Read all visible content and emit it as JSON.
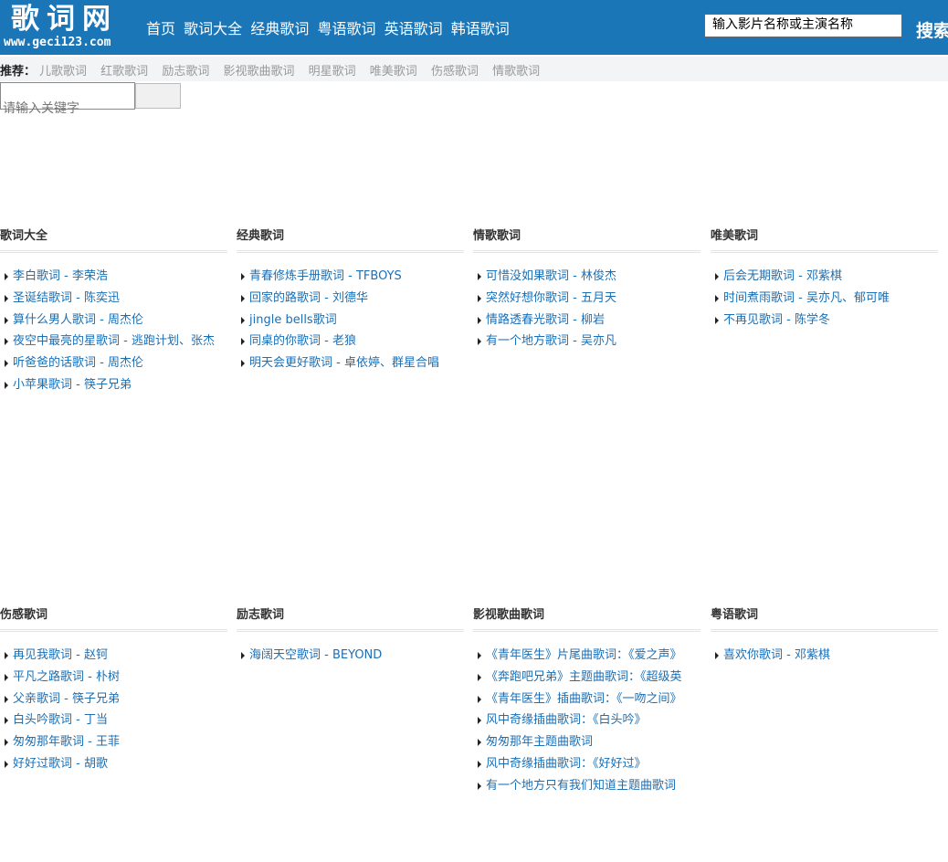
{
  "header": {
    "logo_title": "歌词网",
    "logo_url": "www.geci123.com",
    "nav": [
      "首页",
      "歌词大全",
      "经典歌词",
      "粤语歌词",
      "英语歌词",
      "韩语歌词"
    ],
    "search_value": "输入影片名称或主演名称",
    "search_button": "搜索"
  },
  "recommend": {
    "label": "推荐：",
    "links": [
      "儿歌歌词",
      "红歌歌词",
      "励志歌词",
      "影视歌曲歌词",
      "明星歌词",
      "唯美歌词",
      "伤感歌词",
      "情歌歌词"
    ]
  },
  "keyword_search": {
    "placeholder": "请输入关键字",
    "button": ""
  },
  "sections": [
    {
      "title": "歌词大全",
      "items": [
        "李白歌词 - 李荣浩",
        "圣诞结歌词 - 陈奕迅",
        "算什么男人歌词 - 周杰伦",
        "夜空中最亮的星歌词 - 逃跑计划、张杰",
        "听爸爸的话歌词 - 周杰伦",
        "小苹果歌词 - 筷子兄弟"
      ]
    },
    {
      "title": "经典歌词",
      "items": [
        "青春修炼手册歌词 - TFBOYS",
        "回家的路歌词 - 刘德华",
        "jingle bells歌词",
        "同桌的你歌词 - 老狼",
        "明天会更好歌词 - 卓依婷、群星合唱"
      ]
    },
    {
      "title": "情歌歌词",
      "items": [
        "可惜没如果歌词 - 林俊杰",
        "突然好想你歌词 - 五月天",
        "情路透春光歌词 - 柳岩",
        "有一个地方歌词 - 吴亦凡"
      ]
    },
    {
      "title": "唯美歌词",
      "items": [
        "后会无期歌词 - 邓紫棋",
        "时间煮雨歌词 - 吴亦凡、郁可唯",
        "不再见歌词 - 陈学冬"
      ]
    },
    {
      "title": "伤感歌词",
      "items": [
        "再见我歌词 - 赵钶",
        "平凡之路歌词 - 朴树",
        "父亲歌词 - 筷子兄弟",
        "白头吟歌词 - 丁当",
        "匆匆那年歌词 - 王菲",
        "好好过歌词 - 胡歌"
      ]
    },
    {
      "title": "励志歌词",
      "items": [
        "海阔天空歌词 - BEYOND"
      ]
    },
    {
      "title": "影视歌曲歌词",
      "items": [
        "《青年医生》片尾曲歌词：《爱之声》",
        "《奔跑吧兄弟》主题曲歌词：《超级英",
        "《青年医生》插曲歌词：《一吻之间》",
        "风中奇缘插曲歌词：《白头吟》",
        "匆匆那年主题曲歌词",
        "风中奇缘插曲歌词：《好好过》",
        "有一个地方只有我们知道主题曲歌词"
      ]
    },
    {
      "title": "粤语歌词",
      "items": [
        "喜欢你歌词 - 邓紫棋"
      ]
    }
  ]
}
